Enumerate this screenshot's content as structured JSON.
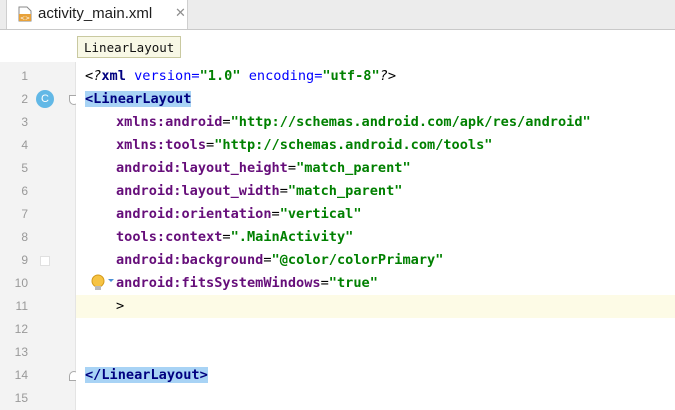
{
  "tab": {
    "file_name": "activity_main.xml",
    "close_glyph": "✕",
    "icon": "xml-file-icon"
  },
  "breadcrumb": {
    "element": "LinearLayout"
  },
  "gutter": {
    "line_numbers": [
      "1",
      "2",
      "3",
      "4",
      "5",
      "6",
      "7",
      "8",
      "9",
      "10",
      "11",
      "12",
      "13",
      "14",
      "15"
    ],
    "class_marker": "C"
  },
  "code": {
    "line1": {
      "open": "<?",
      "kw": "xml",
      "attrs": " version=",
      "v1": "\"1.0\"",
      "sp": " encoding=",
      "v2": "\"utf-8\"",
      "close": "?>"
    },
    "line2": {
      "tag": "<LinearLayout"
    },
    "line3": {
      "ns": "xmlns:",
      "name": "android",
      "eq": "=",
      "value": "\"http://schemas.android.com/apk/res/android\""
    },
    "line4": {
      "ns": "xmlns:",
      "name": "tools",
      "eq": "=",
      "value": "\"http://schemas.android.com/tools\""
    },
    "line5": {
      "name": "android:layout_height",
      "eq": "=",
      "value": "\"match_parent\""
    },
    "line6": {
      "name": "android:layout_width",
      "eq": "=",
      "value": "\"match_parent\""
    },
    "line7": {
      "name": "android:orientation",
      "eq": "=",
      "value": "\"vertical\""
    },
    "line8": {
      "name": "tools:context",
      "eq": "=",
      "value": "\".MainActivity\""
    },
    "line9": {
      "name": "android:background",
      "eq": "=",
      "value": "\"@color/colorPrimary\""
    },
    "line10": {
      "name": "android:fitsSystemWindows",
      "eq": "=",
      "value": "\"true\""
    },
    "line11": {
      "text": ">"
    },
    "line14": {
      "tag": "</LinearLayout>"
    }
  },
  "colors": {
    "tag_highlight": "#a8d3f5",
    "class_badge": "#62b8e6",
    "caret_line": "#fdfbe6",
    "string_value": "#008000",
    "attribute": "#660e7a"
  }
}
